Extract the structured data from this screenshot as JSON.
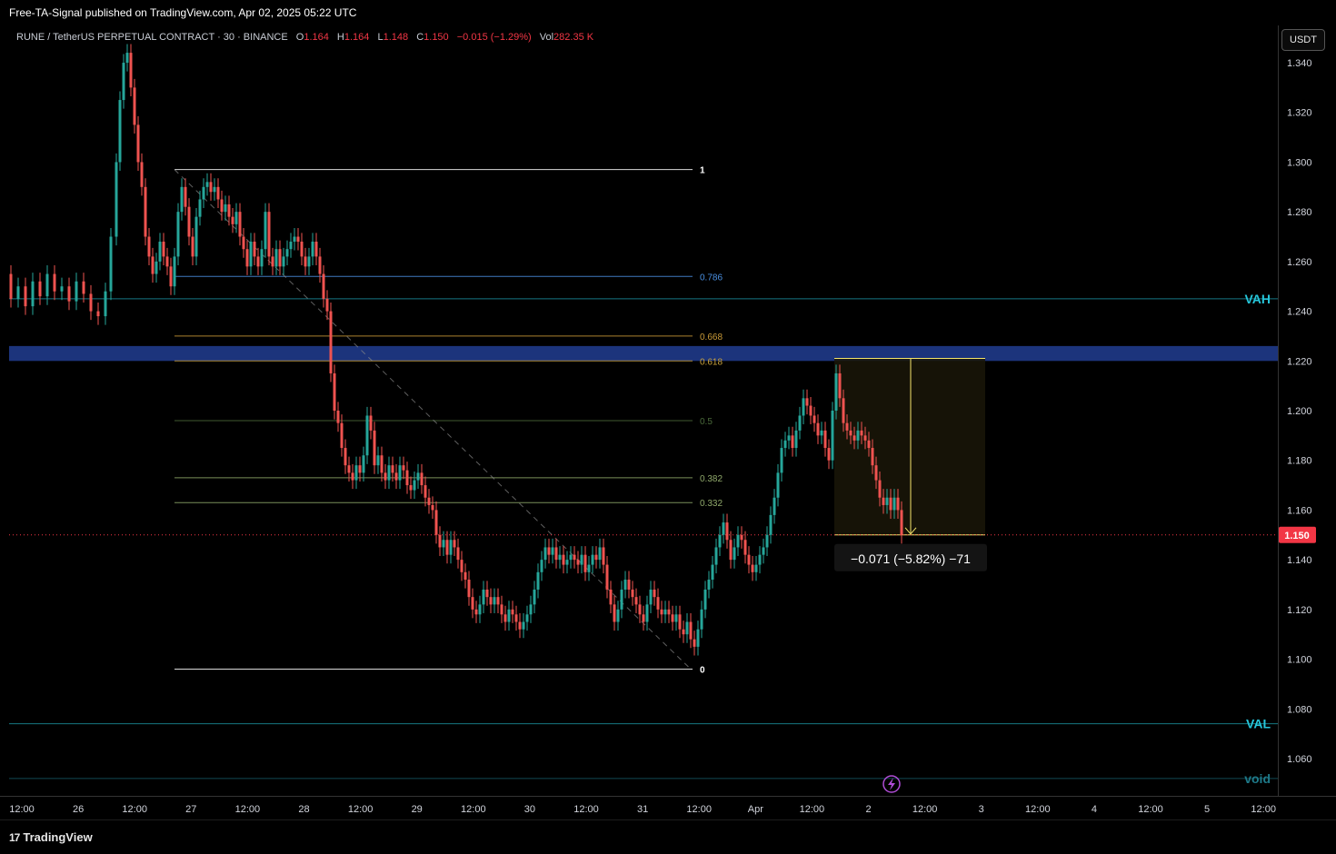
{
  "header": {
    "published": "Free-TA-Signal published on TradingView.com, Apr 02, 2025 05:22 UTC"
  },
  "legend": {
    "symbol": "RUNE / TetherUS PERPETUAL CONTRACT · 30 · BINANCE",
    "o_label": "O",
    "o": "1.164",
    "h_label": "H",
    "h": "1.164",
    "l_label": "L",
    "l": "1.148",
    "c_label": "C",
    "c": "1.150",
    "change": "−0.015 (−1.29%)",
    "vol_label": "Vol",
    "vol": "282.35 K"
  },
  "unit_button": "USDT",
  "footer": {
    "brand": "TradingView",
    "mark": "17"
  },
  "chart_data": {
    "type": "candlestick",
    "symbol": "RUNEUSDT.P",
    "interval": "30",
    "ylim": [
      1.045,
      1.355
    ],
    "y_ticks": [
      "1.340",
      "1.320",
      "1.300",
      "1.280",
      "1.260",
      "1.240",
      "1.220",
      "1.200",
      "1.180",
      "1.160",
      "1.140",
      "1.120",
      "1.100",
      "1.080",
      "1.060"
    ],
    "x_ticks": [
      "12:00",
      "26",
      "12:00",
      "27",
      "12:00",
      "28",
      "12:00",
      "29",
      "12:00",
      "30",
      "12:00",
      "31",
      "12:00",
      "Apr",
      "12:00",
      "2",
      "12:00",
      "3",
      "12:00",
      "4",
      "12:00",
      "5",
      "12:00"
    ],
    "last_price": "1.150",
    "price_path": [
      [
        0,
        1.255
      ],
      [
        8,
        1.245
      ],
      [
        16,
        1.25
      ],
      [
        24,
        1.242
      ],
      [
        32,
        1.252
      ],
      [
        40,
        1.246
      ],
      [
        48,
        1.255
      ],
      [
        56,
        1.248
      ],
      [
        64,
        1.25
      ],
      [
        72,
        1.244
      ],
      [
        80,
        1.252
      ],
      [
        88,
        1.247
      ],
      [
        96,
        1.24
      ],
      [
        104,
        1.238
      ],
      [
        110,
        1.248
      ],
      [
        116,
        1.27
      ],
      [
        120,
        1.3
      ],
      [
        124,
        1.325
      ],
      [
        128,
        1.34
      ],
      [
        132,
        1.344
      ],
      [
        136,
        1.33
      ],
      [
        140,
        1.315
      ],
      [
        144,
        1.3
      ],
      [
        148,
        1.29
      ],
      [
        152,
        1.27
      ],
      [
        156,
        1.262
      ],
      [
        160,
        1.255
      ],
      [
        164,
        1.26
      ],
      [
        168,
        1.268
      ],
      [
        172,
        1.262
      ],
      [
        176,
        1.258
      ],
      [
        180,
        1.25
      ],
      [
        184,
        1.262
      ],
      [
        188,
        1.28
      ],
      [
        192,
        1.29
      ],
      [
        196,
        1.282
      ],
      [
        200,
        1.27
      ],
      [
        204,
        1.262
      ],
      [
        208,
        1.278
      ],
      [
        212,
        1.285
      ],
      [
        216,
        1.29
      ],
      [
        220,
        1.292
      ],
      [
        224,
        1.288
      ],
      [
        228,
        1.29
      ],
      [
        232,
        1.285
      ],
      [
        236,
        1.28
      ],
      [
        240,
        1.283
      ],
      [
        244,
        1.278
      ],
      [
        248,
        1.275
      ],
      [
        252,
        1.28
      ],
      [
        256,
        1.27
      ],
      [
        260,
        1.265
      ],
      [
        264,
        1.258
      ],
      [
        268,
        1.268
      ],
      [
        272,
        1.262
      ],
      [
        276,
        1.258
      ],
      [
        280,
        1.265
      ],
      [
        284,
        1.28
      ],
      [
        288,
        1.262
      ],
      [
        292,
        1.258
      ],
      [
        296,
        1.265
      ],
      [
        300,
        1.258
      ],
      [
        304,
        1.262
      ],
      [
        308,
        1.265
      ],
      [
        312,
        1.268
      ],
      [
        316,
        1.27
      ],
      [
        320,
        1.268
      ],
      [
        324,
        1.262
      ],
      [
        328,
        1.258
      ],
      [
        332,
        1.262
      ],
      [
        336,
        1.268
      ],
      [
        340,
        1.262
      ],
      [
        344,
        1.255
      ],
      [
        348,
        1.245
      ],
      [
        352,
        1.24
      ],
      [
        356,
        1.215
      ],
      [
        360,
        1.2
      ],
      [
        364,
        1.195
      ],
      [
        368,
        1.185
      ],
      [
        372,
        1.178
      ],
      [
        376,
        1.175
      ],
      [
        380,
        1.172
      ],
      [
        384,
        1.178
      ],
      [
        388,
        1.175
      ],
      [
        392,
        1.182
      ],
      [
        396,
        1.198
      ],
      [
        400,
        1.192
      ],
      [
        404,
        1.178
      ],
      [
        408,
        1.182
      ],
      [
        412,
        1.175
      ],
      [
        416,
        1.172
      ],
      [
        420,
        1.178
      ],
      [
        424,
        1.175
      ],
      [
        428,
        1.172
      ],
      [
        432,
        1.178
      ],
      [
        436,
        1.176
      ],
      [
        440,
        1.17
      ],
      [
        444,
        1.168
      ],
      [
        448,
        1.172
      ],
      [
        452,
        1.175
      ],
      [
        456,
        1.17
      ],
      [
        460,
        1.165
      ],
      [
        464,
        1.162
      ],
      [
        468,
        1.16
      ],
      [
        472,
        1.15
      ],
      [
        476,
        1.145
      ],
      [
        480,
        1.148
      ],
      [
        484,
        1.142
      ],
      [
        488,
        1.148
      ],
      [
        492,
        1.145
      ],
      [
        496,
        1.14
      ],
      [
        500,
        1.135
      ],
      [
        504,
        1.132
      ],
      [
        508,
        1.125
      ],
      [
        512,
        1.12
      ],
      [
        516,
        1.118
      ],
      [
        520,
        1.122
      ],
      [
        524,
        1.128
      ],
      [
        528,
        1.125
      ],
      [
        532,
        1.122
      ],
      [
        536,
        1.125
      ],
      [
        540,
        1.122
      ],
      [
        544,
        1.118
      ],
      [
        548,
        1.115
      ],
      [
        552,
        1.12
      ],
      [
        556,
        1.118
      ],
      [
        560,
        1.115
      ],
      [
        564,
        1.112
      ],
      [
        568,
        1.115
      ],
      [
        572,
        1.118
      ],
      [
        576,
        1.122
      ],
      [
        580,
        1.128
      ],
      [
        584,
        1.135
      ],
      [
        588,
        1.14
      ],
      [
        592,
        1.145
      ],
      [
        596,
        1.142
      ],
      [
        600,
        1.145
      ],
      [
        604,
        1.14
      ],
      [
        608,
        1.142
      ],
      [
        612,
        1.138
      ],
      [
        616,
        1.14
      ],
      [
        620,
        1.142
      ],
      [
        624,
        1.14
      ],
      [
        628,
        1.138
      ],
      [
        632,
        1.142
      ],
      [
        636,
        1.135
      ],
      [
        640,
        1.138
      ],
      [
        644,
        1.142
      ],
      [
        648,
        1.14
      ],
      [
        652,
        1.145
      ],
      [
        656,
        1.138
      ],
      [
        660,
        1.128
      ],
      [
        664,
        1.122
      ],
      [
        668,
        1.115
      ],
      [
        672,
        1.12
      ],
      [
        676,
        1.128
      ],
      [
        680,
        1.132
      ],
      [
        684,
        1.128
      ],
      [
        688,
        1.125
      ],
      [
        692,
        1.122
      ],
      [
        696,
        1.118
      ],
      [
        700,
        1.115
      ],
      [
        704,
        1.122
      ],
      [
        708,
        1.128
      ],
      [
        712,
        1.125
      ],
      [
        716,
        1.12
      ],
      [
        720,
        1.118
      ],
      [
        724,
        1.12
      ],
      [
        728,
        1.118
      ],
      [
        732,
        1.115
      ],
      [
        736,
        1.118
      ],
      [
        740,
        1.112
      ],
      [
        744,
        1.11
      ],
      [
        748,
        1.115
      ],
      [
        752,
        1.108
      ],
      [
        756,
        1.105
      ],
      [
        760,
        1.112
      ],
      [
        764,
        1.12
      ],
      [
        768,
        1.128
      ],
      [
        772,
        1.132
      ],
      [
        776,
        1.138
      ],
      [
        780,
        1.145
      ],
      [
        784,
        1.15
      ],
      [
        788,
        1.155
      ],
      [
        792,
        1.148
      ],
      [
        796,
        1.14
      ],
      [
        800,
        1.145
      ],
      [
        804,
        1.15
      ],
      [
        808,
        1.148
      ],
      [
        812,
        1.142
      ],
      [
        816,
        1.138
      ],
      [
        820,
        1.135
      ],
      [
        824,
        1.138
      ],
      [
        828,
        1.142
      ],
      [
        832,
        1.145
      ],
      [
        836,
        1.15
      ],
      [
        840,
        1.158
      ],
      [
        844,
        1.165
      ],
      [
        848,
        1.175
      ],
      [
        852,
        1.185
      ],
      [
        856,
        1.188
      ],
      [
        860,
        1.19
      ],
      [
        864,
        1.185
      ],
      [
        868,
        1.192
      ],
      [
        872,
        1.198
      ],
      [
        876,
        1.205
      ],
      [
        880,
        1.202
      ],
      [
        884,
        1.198
      ],
      [
        888,
        1.195
      ],
      [
        892,
        1.19
      ],
      [
        896,
        1.192
      ],
      [
        900,
        1.185
      ],
      [
        904,
        1.18
      ],
      [
        908,
        1.2
      ],
      [
        912,
        1.215
      ],
      [
        916,
        1.205
      ],
      [
        920,
        1.195
      ],
      [
        924,
        1.192
      ],
      [
        928,
        1.19
      ],
      [
        932,
        1.188
      ],
      [
        936,
        1.192
      ],
      [
        940,
        1.19
      ],
      [
        944,
        1.188
      ],
      [
        948,
        1.185
      ],
      [
        952,
        1.178
      ],
      [
        956,
        1.172
      ],
      [
        960,
        1.165
      ],
      [
        964,
        1.162
      ],
      [
        968,
        1.165
      ],
      [
        972,
        1.16
      ],
      [
        976,
        1.165
      ],
      [
        980,
        1.16
      ],
      [
        984,
        1.15
      ]
    ],
    "fibonacci": {
      "high": 1.297,
      "low": 1.096,
      "levels": [
        {
          "ratio": "1",
          "price": 1.297,
          "color": "#ffffff"
        },
        {
          "ratio": "0.786",
          "price": 1.254,
          "color": "#4a90e2"
        },
        {
          "ratio": "0.668",
          "price": 1.23,
          "color": "#c99a38"
        },
        {
          "ratio": "0.618",
          "price": 1.22,
          "color": "#c9a13a"
        },
        {
          "ratio": "0.5",
          "price": 1.196,
          "color": "#4a6a3a"
        },
        {
          "ratio": "0.382",
          "price": 1.173,
          "color": "#8fa86a"
        },
        {
          "ratio": "0.332",
          "price": 1.163,
          "color": "#8fa86a"
        },
        {
          "ratio": "0",
          "price": 1.096,
          "color": "#ffffff"
        }
      ]
    },
    "horizontal_levels": [
      {
        "label": "VAH",
        "price": 1.245,
        "color": "#26c6da"
      },
      {
        "label": "VAL",
        "price": 1.074,
        "color": "#26c6da"
      },
      {
        "label": "void",
        "price": 1.052,
        "color": "#1e7a8a"
      }
    ],
    "zone": {
      "from": 1.22,
      "to": 1.226,
      "color": "#1f3a8a"
    },
    "measure": {
      "from": 1.221,
      "to": 1.15,
      "label": "−0.071 (−5.82%) −71"
    }
  }
}
